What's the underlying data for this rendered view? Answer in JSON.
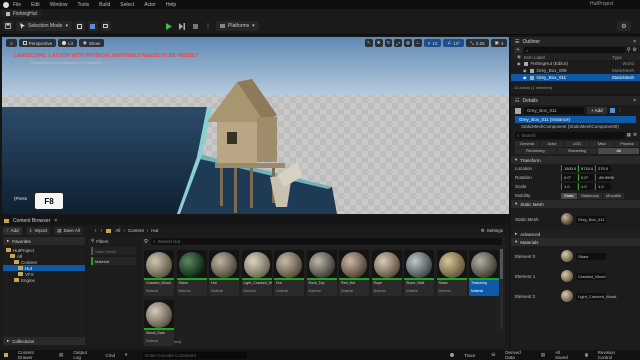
{
  "app": {
    "title": "HutProject",
    "project_tab": "FishingHut"
  },
  "menu": [
    "File",
    "Edit",
    "Window",
    "Tools",
    "Build",
    "Select",
    "Actor",
    "Help"
  ],
  "toolbar": {
    "selection_mode": "Selection Mode",
    "platforms": "Platforms"
  },
  "viewport": {
    "perspective": "Perspective",
    "lit": "Lit",
    "show": "Show",
    "grid_snap": "10",
    "rot_snap": "10°",
    "scale_snap": "0.25",
    "cam_speed": "4",
    "warning": "LANDSCAPE: 1 ACTOR WITH PHYSICAL MATERIALS NEEDS TO BE REBUILT",
    "warning_sub": "'DisableAllScreenMessages' to suppress",
    "hint": "(Press",
    "key": "F8"
  },
  "outliner": {
    "title": "Outliner",
    "column_label": "Item Label",
    "column_type": "Type",
    "rows": [
      {
        "label": "FishingHut (Editor)",
        "type": "World",
        "selected": false
      },
      {
        "label": "Grey_Box_009",
        "type": "StaticMesh",
        "selected": false
      },
      {
        "label": "Grey_Box_011",
        "type": "StaticMesh",
        "selected": true
      }
    ],
    "footer": "11 actors (1 selected)"
  },
  "details": {
    "title": "Details",
    "object": "Grey_Box_011",
    "add": "+ Add",
    "instance": "Grey_Box_011 (Instance)",
    "component": "StaticMeshComponent (StaticMeshComponent0)",
    "search_placeholder": "Search",
    "tabs_row1": [
      "General",
      "Actor",
      "LOD",
      "Misc",
      "Physics"
    ],
    "tabs_row2": [
      "Rendering",
      "Streaming",
      "All"
    ],
    "transform_label": "Transform",
    "location_label": "Location",
    "location": [
      "1500.0",
      "5715.0",
      "270.0"
    ],
    "rotation_label": "Rotation",
    "rotation": [
      "0.0°",
      "0.0°",
      "-89.9999"
    ],
    "scale_label": "Scale",
    "scale": [
      "1.0",
      "1.0",
      "1.0"
    ],
    "mobility_label": "Mobility",
    "mobility": [
      "Static",
      "Stationary",
      "Movable"
    ],
    "static_mesh_section": "Static Mesh",
    "static_mesh_label": "Static Mesh",
    "static_mesh_value": "Grey_Box_011",
    "advanced_label": "Advanced",
    "materials_section": "Materials",
    "elements": [
      {
        "label": "Element 0",
        "value": "Straw"
      },
      {
        "label": "Element 1",
        "value": "Cracked_Wood"
      },
      {
        "label": "Element 2",
        "value": "Light_Cracked_Wood"
      }
    ]
  },
  "content_browser": {
    "tab_title": "Content Browser",
    "add": "Add",
    "import": "Import",
    "save_all": "Save All",
    "breadcrumb": [
      "All",
      "Content",
      "Hut"
    ],
    "search_placeholder": "Search Hut",
    "settings": "Settings",
    "favorites": "Favorites",
    "tree": [
      {
        "label": "HutProject",
        "depth": 0,
        "selected": false
      },
      {
        "label": "All",
        "depth": 1,
        "selected": false
      },
      {
        "label": "Content",
        "depth": 2,
        "selected": false
      },
      {
        "label": "Hut",
        "depth": 3,
        "selected": true
      },
      {
        "label": "VFX",
        "depth": 3,
        "selected": false
      },
      {
        "label": "Engine",
        "depth": 2,
        "selected": false
      }
    ],
    "collections": "Collections",
    "filters_title": "Filters",
    "filter_static": "Static Mesh",
    "filter_material": "Material",
    "items": [
      {
        "label": "Cracked_Wood",
        "type": "Material",
        "c1": "#cfc6b3",
        "c2": "#5b5242",
        "selected": false
      },
      {
        "label": "Glass",
        "type": "Material",
        "c1": "#5b8a62",
        "c2": "#0b1f10",
        "selected": false
      },
      {
        "label": "Hut",
        "type": "Material",
        "c1": "#bfb6a4",
        "c2": "#4a4234",
        "selected": false
      },
      {
        "label": "Light_Cracked_Wood",
        "type": "Material",
        "c1": "#ddd5c3",
        "c2": "#6b6252",
        "selected": false
      },
      {
        "label": "Hut",
        "type": "Material",
        "c1": "#c7bca6",
        "c2": "#554a3a",
        "selected": false
      },
      {
        "label": "Rock_Top",
        "type": "Material",
        "c1": "#bdb7aa",
        "c2": "#3c3932",
        "selected": false
      },
      {
        "label": "Red_Hut",
        "type": "Material",
        "c1": "#cbb8a7",
        "c2": "#4d3d31",
        "selected": false
      },
      {
        "label": "Rope",
        "type": "Material",
        "c1": "#d9ccb8",
        "c2": "#5a4c3c",
        "selected": false
      },
      {
        "label": "Stone_Wall",
        "type": "Material",
        "c1": "#bfc7c9",
        "c2": "#3c4448",
        "selected": false
      },
      {
        "label": "Straw",
        "type": "Material",
        "c1": "#d8c79a",
        "c2": "#5f5236",
        "selected": false
      },
      {
        "label": "Thatching",
        "type": "Material",
        "c1": "#b7b1a3",
        "c2": "#3a372f",
        "selected": true
      },
      {
        "label": "Wood_Dark",
        "type": "Material",
        "c1": "#d3ccbc",
        "c2": "#5a5344",
        "selected": false
      }
    ],
    "footer": "12 items (1 selected)"
  },
  "statusbar": {
    "content_drawer": "Content Drawer",
    "output_log": "Output Log",
    "cmd": "Cmd",
    "console_placeholder": "Enter Console Command",
    "trace": "Trace",
    "derived_data": "Derived Data",
    "unsaved": "All Saved",
    "revision": "Revision Control"
  },
  "colors": {
    "accent": "#0e5aa7",
    "warning": "#ff4040",
    "green": "#1fa61f"
  }
}
